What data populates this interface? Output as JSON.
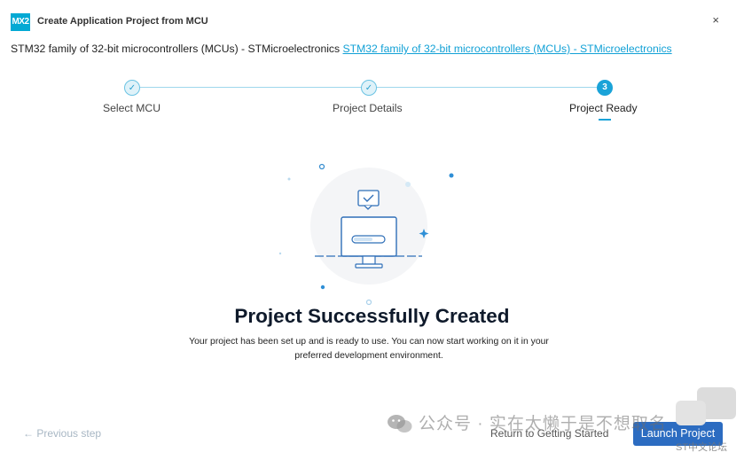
{
  "window": {
    "logo_text": "MX2",
    "title": "Create Application Project from MCU",
    "close_glyph": "×"
  },
  "header": {
    "text": "STM32 family of 32-bit microcontrollers (MCUs) - STMicroelectronics",
    "link": "STM32 family of 32-bit microcontrollers (MCUs) - STMicroelectronics"
  },
  "stepper": {
    "steps": [
      {
        "label": "Select MCU",
        "status": "done",
        "marker": "✓"
      },
      {
        "label": "Project Details",
        "status": "done",
        "marker": "✓"
      },
      {
        "label": "Project Ready",
        "status": "current",
        "marker": "3"
      }
    ]
  },
  "success": {
    "title": "Project Successfully Created",
    "line1": "Your project has been set up and is ready to use. You can now start working on it in your",
    "line2": "preferred development environment."
  },
  "footer": {
    "previous": "← Previous step",
    "return": "Return to Getting Started",
    "launch": "Launch Project"
  },
  "watermark": {
    "text": "公众号 · 实在太懒于是不想取名",
    "forum": "ST中文论坛"
  },
  "colors": {
    "accent": "#1aa3d8",
    "link": "#12a1d6",
    "primary_button": "#2c6cc1",
    "disabled_text": "#a8b7c4"
  }
}
